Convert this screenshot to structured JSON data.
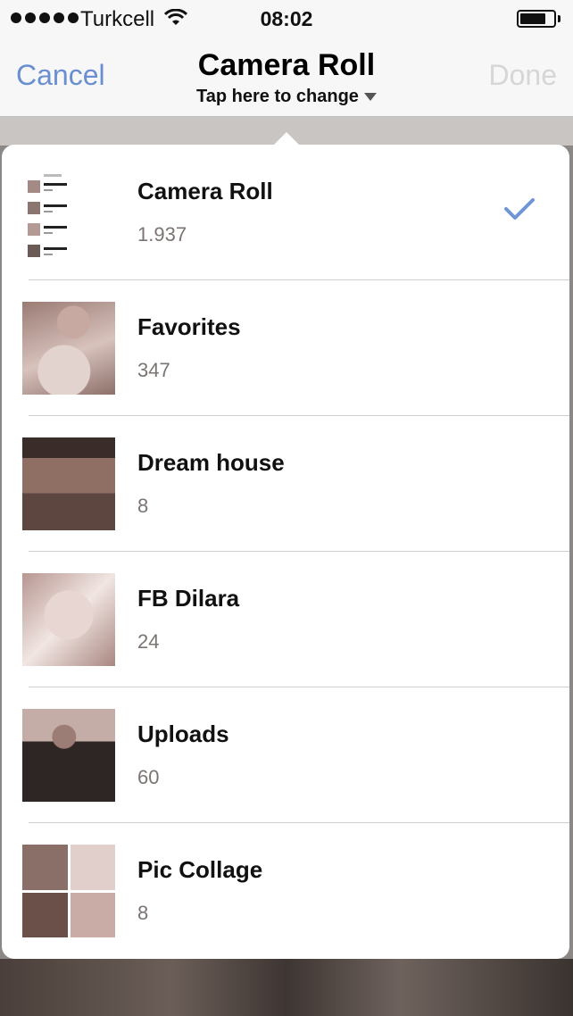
{
  "status_bar": {
    "carrier": "Turkcell",
    "time": "08:02"
  },
  "nav": {
    "cancel_label": "Cancel",
    "title": "Camera Roll",
    "subtitle": "Tap here to change",
    "done_label": "Done"
  },
  "albums": [
    {
      "name": "Camera Roll",
      "count": "1.937",
      "selected": true,
      "thumb": "camera-roll-thumbnail"
    },
    {
      "name": "Favorites",
      "count": "347",
      "selected": false,
      "thumb": "favorites-thumbnail"
    },
    {
      "name": "Dream house",
      "count": "8",
      "selected": false,
      "thumb": "dream-house-thumbnail"
    },
    {
      "name": "FB Dilara",
      "count": "24",
      "selected": false,
      "thumb": "fb-dilara-thumbnail"
    },
    {
      "name": "Uploads",
      "count": "60",
      "selected": false,
      "thumb": "uploads-thumbnail"
    },
    {
      "name": "Pic Collage",
      "count": "8",
      "selected": false,
      "thumb": "pic-collage-thumbnail"
    }
  ],
  "colors": {
    "accent": "#6a8fd0",
    "checkmark": "#6f95d6",
    "disabled": "#d6d6d6",
    "count_text": "#7a7472"
  },
  "icons": [
    "signal-dots-icon",
    "wifi-icon",
    "battery-icon",
    "triangle-down-icon",
    "checkmark-icon"
  ]
}
